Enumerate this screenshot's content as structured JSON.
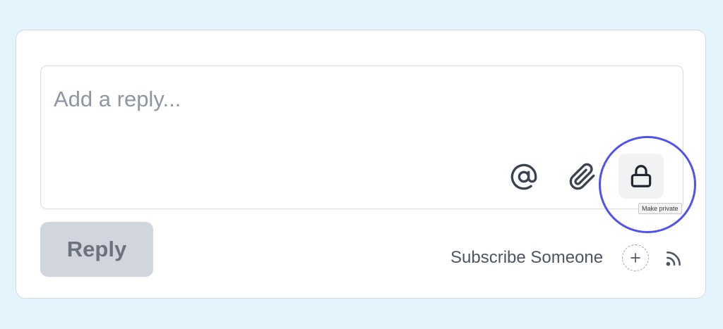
{
  "reply_box": {
    "placeholder": "Add a reply...",
    "value": ""
  },
  "toolbar": {
    "mention_icon": "at-sign-icon",
    "attach_icon": "paperclip-icon",
    "private_icon": "lock-icon",
    "private_tooltip": "Make private"
  },
  "actions": {
    "reply_label": "Reply",
    "subscribe_label": "Subscribe Someone",
    "add_icon": "plus-icon",
    "rss_icon": "rss-icon"
  },
  "colors": {
    "background": "#e3f4fd",
    "highlight": "#5151f0",
    "reply_button_bg": "#d1d5dd",
    "icon": "#3b4350"
  }
}
